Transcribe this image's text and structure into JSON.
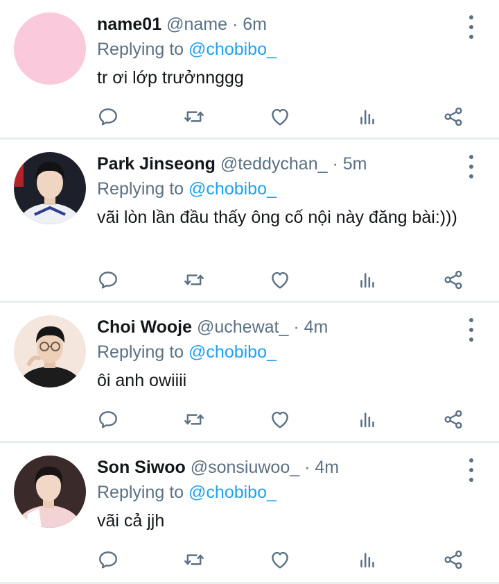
{
  "replying_label": "Replying to",
  "replies": [
    {
      "name": "name01",
      "handle": "@name",
      "dot": "·",
      "time": "6m",
      "replying_to": "@chobibo_",
      "text": "tr ơi lớp trưởnnggg",
      "avatar": "pink-placeholder-avatar"
    },
    {
      "name": "Park Jinseong",
      "handle": "@teddychan_",
      "dot": "·",
      "time": "5m",
      "replying_to": "@chobibo_",
      "text": "vãi lòn lần đầu thấy ông cố nội này đăng bài:)))",
      "avatar": "person-photo-avatar"
    },
    {
      "name": "Choi Wooje",
      "handle": "@uchewat_",
      "dot": "·",
      "time": "4m",
      "replying_to": "@chobibo_",
      "text": "ôi anh owiiii",
      "avatar": "person-photo-avatar"
    },
    {
      "name": "Son Siwoo",
      "handle": "@sonsiuwoo_",
      "dot": "·",
      "time": "4m",
      "replying_to": "@chobibo_",
      "text": "vãi cả jjh",
      "avatar": "person-photo-avatar"
    }
  ],
  "colors": {
    "name": "#14171a",
    "secondary": "#5b7083",
    "mention": "#1da1f2",
    "divider": "#e9ecee",
    "pink_avatar": "#fbc9dc"
  },
  "icons": [
    "reply-icon",
    "retweet-icon",
    "like-icon",
    "analytics-icon",
    "share-icon",
    "more-vertical-icon"
  ]
}
